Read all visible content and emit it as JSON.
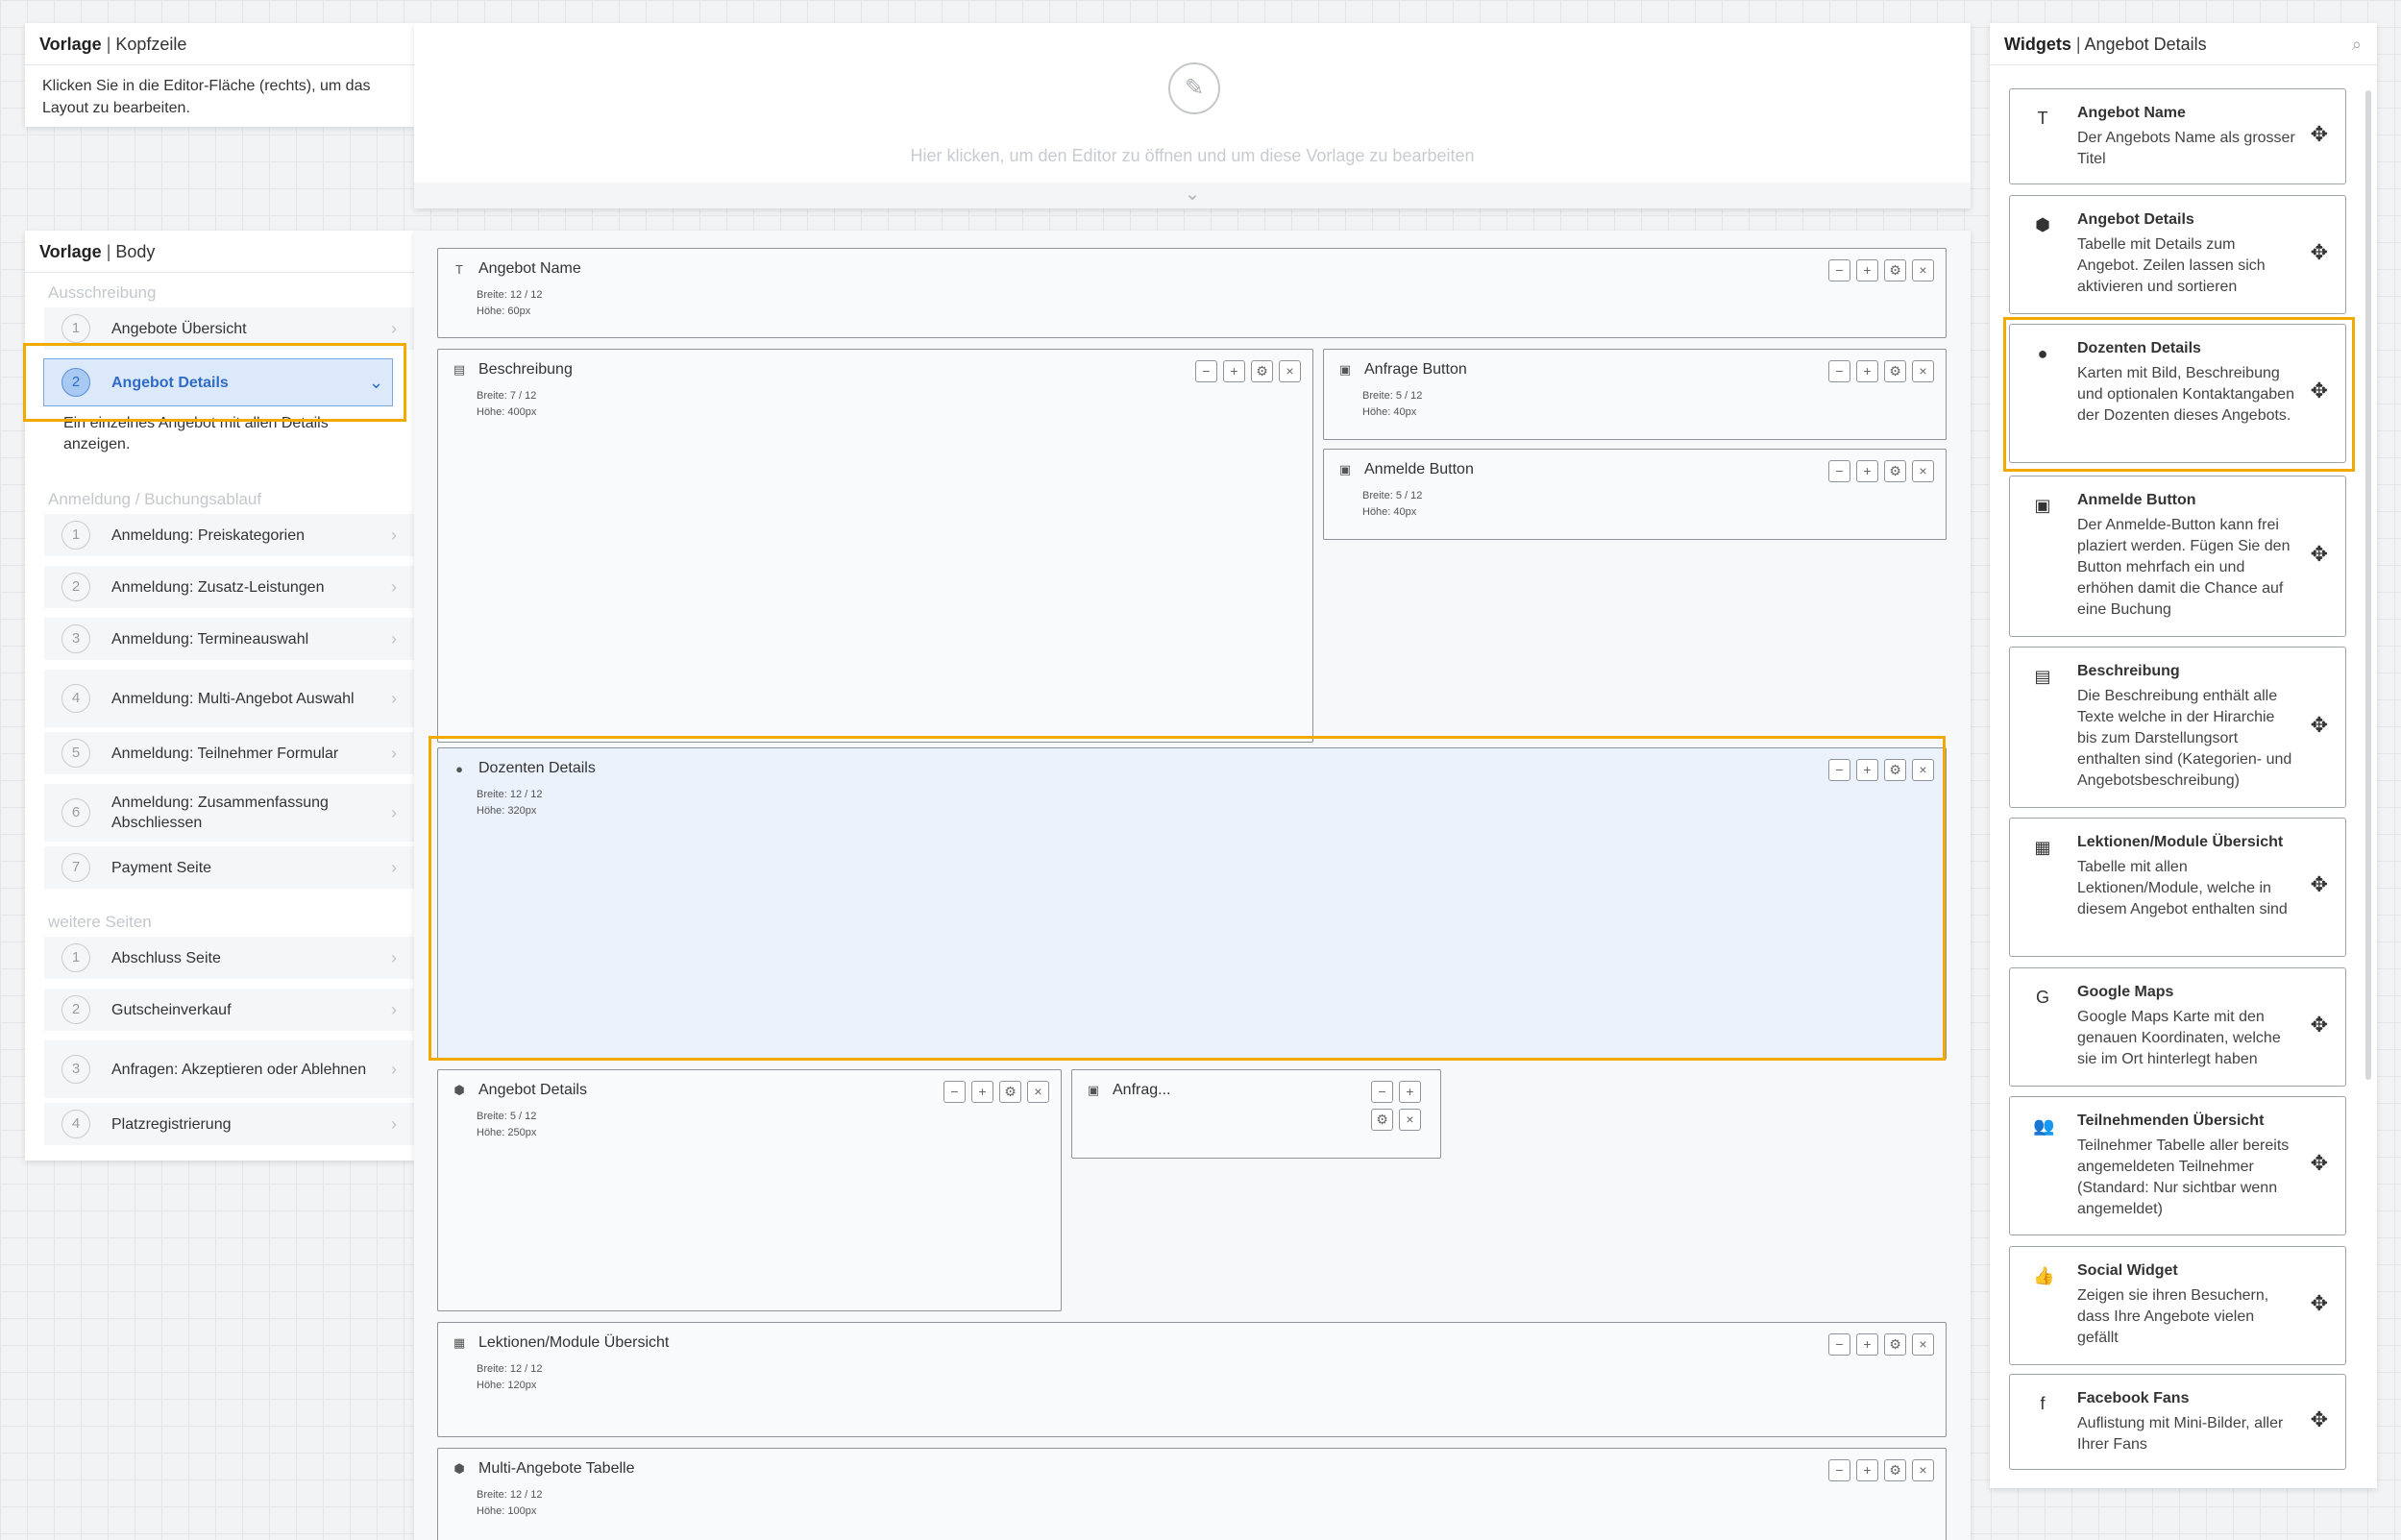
{
  "kopf": {
    "title_bold": "Vorlage",
    "title_rest": "Kopfzeile",
    "info": "Klicken Sie in die Editor-Fläche (rechts), um das Layout zu bearbeiten.",
    "editor_hint": "Hier klicken, um den Editor zu öffnen und um diese Vorlage zu bearbeiten"
  },
  "body": {
    "title_bold": "Vorlage",
    "title_rest": "Body"
  },
  "nav": {
    "group1": "Ausschreibung",
    "group2": "Anmeldung / Buchungsablauf",
    "group3": "weitere Seiten",
    "active_desc": "Ein einzelnes Angebot mit allen Details anzeigen.",
    "items": [
      {
        "num": "1",
        "label": "Angebote Übersicht"
      },
      {
        "num": "2",
        "label": "Angebot Details"
      },
      {
        "num": "1",
        "label": "Anmeldung: Preiskategorien"
      },
      {
        "num": "2",
        "label": "Anmeldung: Zusatz-Leistungen"
      },
      {
        "num": "3",
        "label": "Anmeldung: Termineauswahl"
      },
      {
        "num": "4",
        "label": "Anmeldung: Multi-Angebot Auswahl"
      },
      {
        "num": "5",
        "label": "Anmeldung: Teilnehmer Formular"
      },
      {
        "num": "6",
        "label": "Anmeldung: Zusammenfassung Abschliessen"
      },
      {
        "num": "7",
        "label": "Payment Seite"
      },
      {
        "num": "1",
        "label": "Abschluss Seite"
      },
      {
        "num": "2",
        "label": "Gutscheinverkauf"
      },
      {
        "num": "3",
        "label": "Anfragen: Akzeptieren oder Ablehnen"
      },
      {
        "num": "4",
        "label": "Platzregistrierung"
      }
    ]
  },
  "blocks": [
    {
      "name": "Angebot Name",
      "breite": "Breite: 12 / 12",
      "hoehe": "Höhe: 60px",
      "icon": "text-icon"
    },
    {
      "name": "Beschreibung",
      "breite": "Breite: 7 / 12",
      "hoehe": "Höhe: 400px",
      "icon": "document-icon"
    },
    {
      "name": "Anfrage Button",
      "breite": "Breite: 5 / 12",
      "hoehe": "Höhe: 40px",
      "icon": "clipboard-icon"
    },
    {
      "name": "Anmelde Button",
      "breite": "Breite: 5 / 12",
      "hoehe": "Höhe: 40px",
      "icon": "clipboard-icon"
    },
    {
      "name": "Dozenten Details",
      "breite": "Breite: 12 / 12",
      "hoehe": "Höhe: 320px",
      "icon": "person-icon"
    },
    {
      "name": "Angebot Details",
      "breite": "Breite: 5 / 12",
      "hoehe": "Höhe: 250px",
      "icon": "box-icon"
    },
    {
      "name": "Anfrag...",
      "breite": "",
      "hoehe": "",
      "icon": "clipboard-icon"
    },
    {
      "name": "Lektionen/Module Übersicht",
      "breite": "Breite: 12 / 12",
      "hoehe": "Höhe: 120px",
      "icon": "calendar-icon"
    },
    {
      "name": "Multi-Angebote Tabelle",
      "breite": "Breite: 12 / 12",
      "hoehe": "Höhe: 100px",
      "icon": "boxes-icon"
    }
  ],
  "ctrl": {
    "minus": "−",
    "plus": "+",
    "gear": "⚙",
    "close": "×"
  },
  "widgets_panel": {
    "title_bold": "Widgets",
    "title_rest": "Angebot Details",
    "items": [
      {
        "name": "Angebot Name",
        "desc": "Der Angebots Name als grosser Titel",
        "icon": "T"
      },
      {
        "name": "Angebot Details",
        "desc": "Tabelle mit Details zum Angebot. Zeilen lassen sich aktivieren und sortieren",
        "icon": "⬢"
      },
      {
        "name": "Dozenten Details",
        "desc": "Karten mit Bild, Beschreibung und optionalen Kontaktangaben der Dozenten dieses Angebots.",
        "icon": "●"
      },
      {
        "name": "Anmelde Button",
        "desc": "Der Anmelde-Button kann frei plaziert werden. Fügen Sie den Button mehrfach ein und erhöhen damit die Chance auf eine Buchung",
        "icon": "▣"
      },
      {
        "name": "Beschreibung",
        "desc": "Die Beschreibung enthält alle Texte welche in der Hirarchie bis zum Darstellungsort enthalten sind (Kategorien- und Angebotsbeschreibung)",
        "icon": "▤"
      },
      {
        "name": "Lektionen/Module Übersicht",
        "desc": "Tabelle mit allen Lektionen/Module, welche in diesem Angebot enthalten sind",
        "icon": "▦"
      },
      {
        "name": "Google Maps",
        "desc": "Google Maps Karte mit den genauen Koordinaten, welche sie im Ort hinterlegt haben",
        "icon": "G"
      },
      {
        "name": "Teilnehmenden Übersicht",
        "desc": "Teilnehmer Tabelle aller bereits angemeldeten Teilnehmer (Standard: Nur sichtbar wenn angemeldet)",
        "icon": "👥"
      },
      {
        "name": "Social Widget",
        "desc": "Zeigen sie ihren Besuchern, dass Ihre Angebote vielen gefällt",
        "icon": "👍"
      },
      {
        "name": "Facebook Fans",
        "desc": "Auflistung mit Mini-Bilder, aller Ihrer Fans",
        "icon": "f"
      }
    ]
  },
  "icons": {
    "move": "✥",
    "search": "⌕",
    "chevron_right": "›",
    "chevron_down": "⌄",
    "pencil": "✎",
    "collapse": "⌄"
  }
}
